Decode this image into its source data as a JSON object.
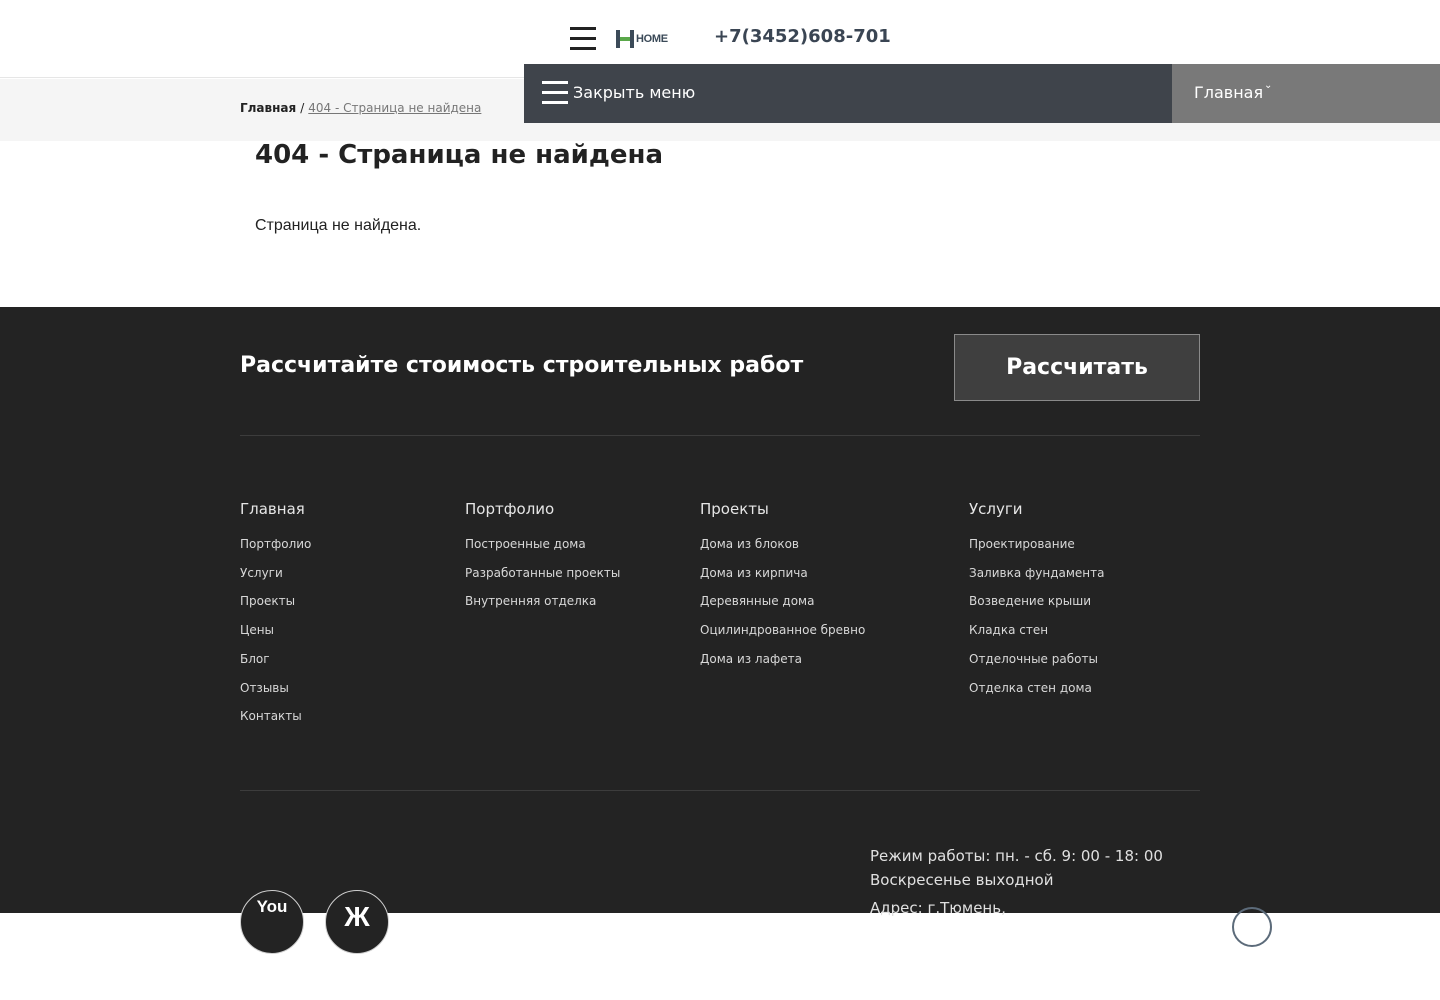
{
  "header": {
    "logo_text": "HOME",
    "phone": "+7(3452)608-701"
  },
  "breadcrumb": {
    "home": "Главная",
    "separator": "/",
    "current": "404 - Страница не найдена"
  },
  "menu": {
    "close_label": "Закрыть меню",
    "side_label": "Главная",
    "side_chevron": "⌄"
  },
  "main": {
    "title": "404 - Страница не найдена",
    "text": "Страница не найдена."
  },
  "footer": {
    "cta_title": "Рассчитайте стоимость строительных работ",
    "cta_button": "Рассчитать",
    "columns": [
      {
        "heading": "Главная",
        "items": [
          "Портфолио",
          "Услуги",
          "Проекты",
          "Цены",
          "Блог",
          "Отзывы",
          "Контакты"
        ]
      },
      {
        "heading": "Портфолио",
        "items": [
          "Построенные дома",
          "Разработанные проекты",
          "Внутренняя отделка"
        ]
      },
      {
        "heading": "Проекты",
        "items": [
          "Дома из блоков",
          "Дома из кирпича",
          "Деревянные дома",
          "Оцилиндрованное бревно",
          "Дома из лафета"
        ]
      },
      {
        "heading": "Услуги",
        "items": [
          "Проектирование",
          "Заливка фундамента",
          "Возведение крыши",
          "Кладка стен",
          "Отделочные работы",
          "Отделка стен дома"
        ]
      }
    ],
    "social": {
      "youtube_label": "You",
      "vk_label": "Ж"
    },
    "info": {
      "hours": "Режим работы: пн. - сб. 9: 00 - 18: 00",
      "weekend": "Воскресенье выходной",
      "address": "Адрес: г.Тюмень,"
    }
  },
  "colors": {
    "footer_bg": "#232323",
    "menu_bg": "#3f444b",
    "menu_side_bg": "#797979",
    "accent_green": "#5aa84a",
    "logo_dark": "#3b4a58"
  }
}
